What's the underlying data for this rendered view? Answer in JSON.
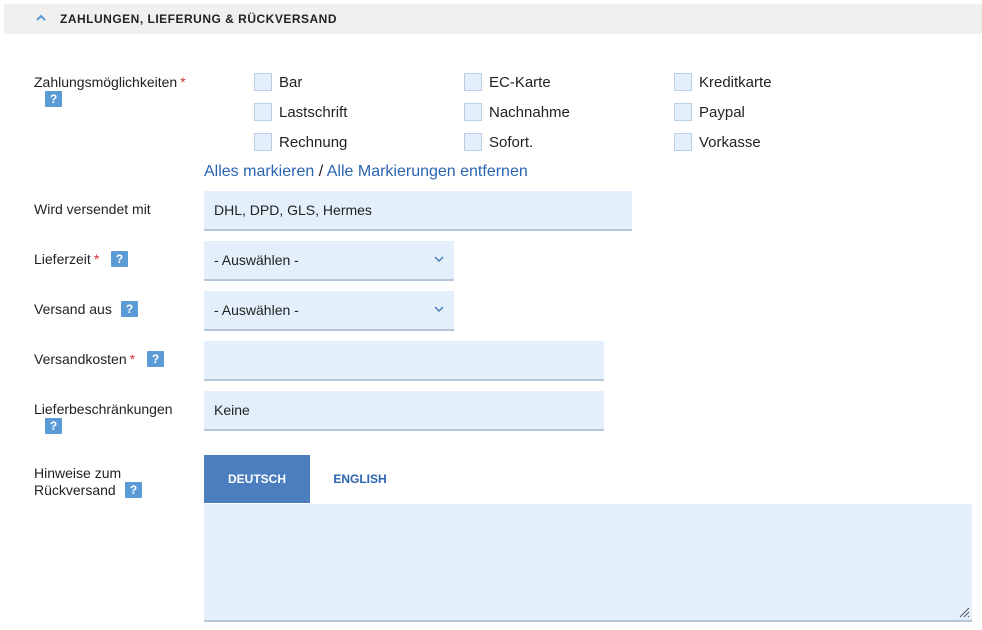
{
  "section": {
    "title": "ZAHLUNGEN, LIEFERUNG & RÜCKVERSAND",
    "chevron_icon": "chevron-up-icon"
  },
  "help_label": "?",
  "required_mark": "*",
  "payment": {
    "label": "Zahlungsmöglichkeiten",
    "options": [
      "Bar",
      "EC-Karte",
      "Kreditkarte",
      "Lastschrift",
      "Nachnahme",
      "Paypal",
      "Rechnung",
      "Sofort.",
      "Vorkasse"
    ],
    "select_all": "Alles markieren",
    "separator": "/",
    "deselect_all": "Alle Markierungen entfernen"
  },
  "shipping_carrier": {
    "label": "Wird versendet mit",
    "value": "DHL, DPD, GLS, Hermes"
  },
  "delivery_time": {
    "label": "Lieferzeit",
    "value": "- Auswählen -"
  },
  "ships_from": {
    "label": "Versand aus",
    "value": "- Auswählen -"
  },
  "shipping_cost": {
    "label": "Versandkosten",
    "value": ""
  },
  "delivery_restrictions": {
    "label": "Lieferbeschränkungen",
    "value": "Keine"
  },
  "return_notes": {
    "label_line1": "Hinweise zum",
    "label_line2": "Rückversand",
    "tabs": [
      "DEUTSCH",
      "ENGLISH"
    ],
    "value": ""
  },
  "colors": {
    "accent": "#4a7ebf",
    "link": "#2b64b0",
    "field_bg": "#e3f0fb",
    "help_bg": "#5b9bd5",
    "required": "#d0343a"
  }
}
